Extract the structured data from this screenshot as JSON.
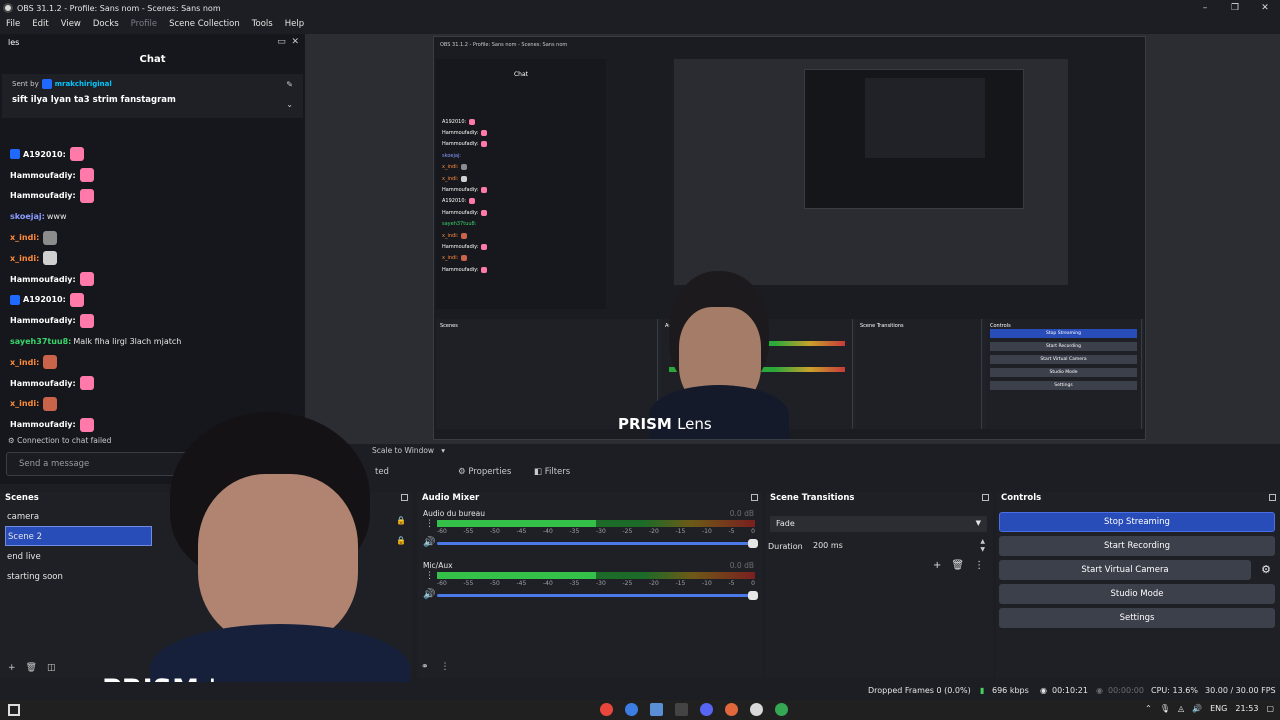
{
  "window": {
    "title": "OBS 31.1.2 - Profile: Sans nom - Scenes: Sans nom",
    "controls": [
      "–",
      "❐",
      "✕"
    ]
  },
  "menu": [
    "File",
    "Edit",
    "View",
    "Docks",
    "Profile",
    "Scene Collection",
    "Tools",
    "Help"
  ],
  "chat_dock": {
    "dock_label": "les",
    "title": "Chat",
    "pinned": {
      "sent_by_prefix": "Sent by",
      "user": "mrakchiriginal",
      "message": "sift ilya lyan ta3 strim fanstagram"
    },
    "messages": [
      {
        "user": "A192010:",
        "color": "#ffffff",
        "badge": true,
        "text": "",
        "emote": "#ff7aa8"
      },
      {
        "user": "Hammoufadiy:",
        "color": "#ffffff",
        "badge": false,
        "text": "",
        "emote": "#ff7aa8"
      },
      {
        "user": "Hammoufadiy:",
        "color": "#ffffff",
        "badge": false,
        "text": "",
        "emote": "#ff7aa8"
      },
      {
        "user": "skoejaj:",
        "color": "#8a9bff",
        "badge": false,
        "text": "www",
        "emote": ""
      },
      {
        "user": "x_indi:",
        "color": "#ff8c3a",
        "badge": false,
        "text": "",
        "emote": "#8c8c8c"
      },
      {
        "user": "x_indi:",
        "color": "#ff8c3a",
        "badge": false,
        "text": "",
        "emote": "#d0d0d0"
      },
      {
        "user": "Hammoufadiy:",
        "color": "#ffffff",
        "badge": false,
        "text": "",
        "emote": "#ff7aa8"
      },
      {
        "user": "A192010:",
        "color": "#ffffff",
        "badge": true,
        "text": "",
        "emote": "#ff7aa8"
      },
      {
        "user": "Hammoufadiy:",
        "color": "#ffffff",
        "badge": false,
        "text": "",
        "emote": "#ff7aa8"
      },
      {
        "user": "sayeh37tuu8:",
        "color": "#38d66b",
        "badge": false,
        "text": "Malk fiha lirgl 3lach mjatch",
        "emote": ""
      },
      {
        "user": "x_indi:",
        "color": "#ff8c3a",
        "badge": false,
        "text": "",
        "emote": "#c9634a"
      },
      {
        "user": "Hammoufadiy:",
        "color": "#ffffff",
        "badge": false,
        "text": "",
        "emote": "#ff7aa8"
      },
      {
        "user": "x_indi:",
        "color": "#ff8c3a",
        "badge": false,
        "text": "",
        "emote": "#c9634a"
      },
      {
        "user": "Hammoufadiy:",
        "color": "#ffffff",
        "badge": false,
        "text": "",
        "emote": "#ff7aa8"
      }
    ],
    "status": "Connection to chat failed",
    "input_placeholder": "Send a message"
  },
  "preview": {
    "overlay_brand": "PRISM",
    "overlay_brand_suffix": "Lens",
    "scale_label": "Scale to Window"
  },
  "source_toolbar": {
    "selected_suffix": "ted",
    "properties": "Properties",
    "filters": "Filters"
  },
  "scenes": {
    "title": "Scenes",
    "items": [
      "camera",
      "Scene 2",
      "end live",
      "starting soon"
    ],
    "selected_index": 1
  },
  "mixer": {
    "title": "Audio Mixer",
    "channels": [
      {
        "name": "Audio du bureau",
        "db": "0.0 dB",
        "level": 0.5
      },
      {
        "name": "Mic/Aux",
        "db": "0.0 dB",
        "level": 0.5
      }
    ],
    "ticks": [
      "-60",
      "-55",
      "-50",
      "-45",
      "-40",
      "-35",
      "-30",
      "-25",
      "-20",
      "-15",
      "-10",
      "-5",
      "0"
    ]
  },
  "transitions": {
    "title": "Scene Transitions",
    "selected": "Fade",
    "duration_label": "Duration",
    "duration_value": "200 ms"
  },
  "controls": {
    "title": "Controls",
    "buttons": [
      "Stop Streaming",
      "Start Recording",
      "Start Virtual Camera",
      "Studio Mode",
      "Settings"
    ]
  },
  "overlay": {
    "brand": "PRISM",
    "suffix": "Lens"
  },
  "status_bar": {
    "dropped_frames": "Dropped Frames 0 (0.0%)",
    "bitrate": "696 kbps",
    "stream_time": "00:10:21",
    "record_time": "00:00:00",
    "cpu": "CPU: 13.6%",
    "fps": "30.00 / 30.00 FPS"
  },
  "taskbar": {
    "language": "ENG",
    "time": "21:53"
  },
  "colors": {
    "accent": "#284cb8",
    "background": "#1f2026"
  }
}
